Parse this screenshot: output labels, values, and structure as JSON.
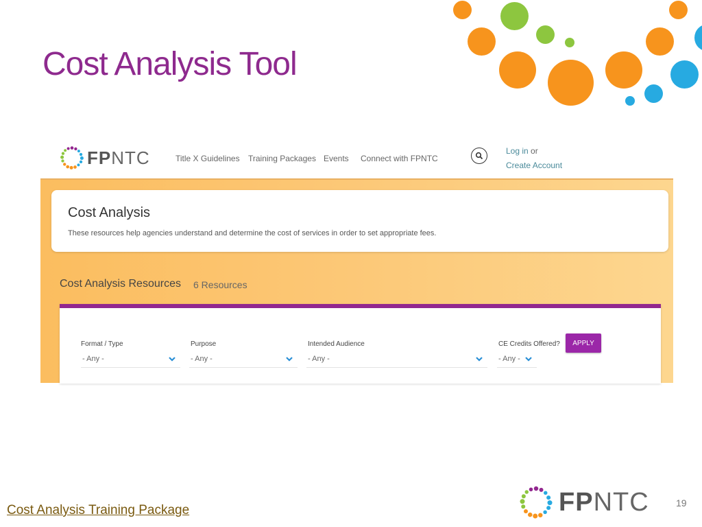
{
  "slide": {
    "title": "Cost Analysis Tool",
    "footer_link": "Cost Analysis Training Package",
    "page_number": "19",
    "footer_logo_text_bold": "FP",
    "footer_logo_text": "NTC"
  },
  "colors": {
    "title": "#8e2a8e",
    "orange": "#f7941d",
    "green": "#8dc63f",
    "blue": "#27aae1",
    "purple_accent": "#92278f",
    "apply_button": "#9b27a8"
  },
  "site": {
    "logo_bold": "FP",
    "logo_rest": "NTC",
    "nav": [
      {
        "label": "Title X Guidelines"
      },
      {
        "label": "Training Packages"
      },
      {
        "label": "Events"
      },
      {
        "label": "Connect with FPNTC"
      }
    ],
    "search_icon": "search-icon",
    "login_label": "Log in",
    "login_or": " or",
    "create_account_label": "Create Account"
  },
  "intro": {
    "title": "Cost Analysis",
    "description": "These resources help agencies understand and determine the cost of services in order to set appropriate fees."
  },
  "resources": {
    "title": "Cost Analysis Resources",
    "count": "6 Resources"
  },
  "filters": [
    {
      "label": "Format / Type",
      "value": "- Any -"
    },
    {
      "label": "Purpose",
      "value": "- Any -"
    },
    {
      "label": "Intended Audience",
      "value": "- Any -"
    },
    {
      "label": "CE Credits Offered?",
      "value": "- Any -"
    }
  ],
  "apply_label": "APPLY"
}
